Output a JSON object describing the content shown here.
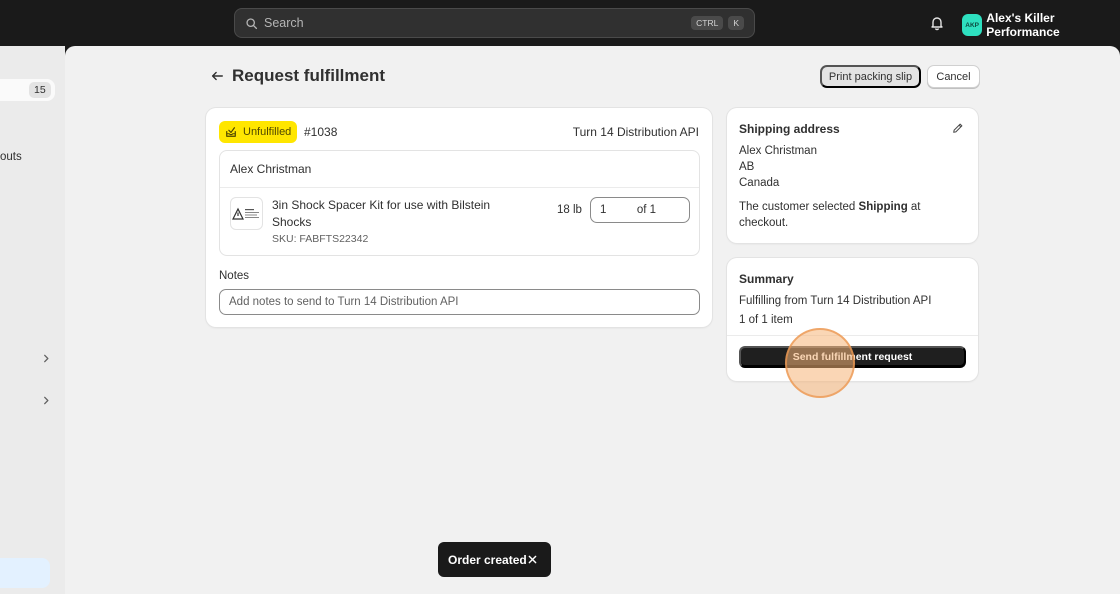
{
  "topbar": {
    "search_placeholder": "Search",
    "shortcut_ctrl": "CTRL",
    "shortcut_key": "K",
    "avatar_initials": "AKP",
    "account_name": "Alex's Killer Performance"
  },
  "sidebar": {
    "count": "15",
    "partial_label": "outs"
  },
  "page": {
    "title": "Request fulfillment",
    "print_label": "Print packing slip",
    "cancel_label": "Cancel"
  },
  "fulfillment": {
    "status": "Unfulfilled",
    "order_number": "#1038",
    "provider": "Turn 14 Distribution API",
    "customer": "Alex Christman",
    "item": {
      "name": "3in Shock Spacer Kit for use with Bilstein Shocks",
      "sku": "SKU: FABFTS22342",
      "weight": "18 lb",
      "quantity": "1",
      "of_total": "of 1"
    },
    "notes_label": "Notes",
    "notes_placeholder": "Add notes to send to Turn 14 Distribution API"
  },
  "shipping": {
    "title": "Shipping address",
    "name": "Alex Christman",
    "region": "AB",
    "country": "Canada",
    "note_prefix": "The customer selected ",
    "note_method": "Shipping",
    "note_suffix": " at checkout."
  },
  "summary": {
    "title": "Summary",
    "source": "Fulfilling from Turn 14 Distribution API",
    "items": "1 of 1 item",
    "button": "Send fulfillment request"
  },
  "toast": {
    "message": "Order created"
  },
  "colors": {
    "status_badge": "#ffe600",
    "avatar": "#2ee0c0",
    "primary_button": "#1f1f1f"
  },
  "icons": [
    "search-icon",
    "bell-icon",
    "back-arrow-icon",
    "fulfillment-status-icon",
    "pencil-icon",
    "chevron-right-icon",
    "close-icon"
  ]
}
